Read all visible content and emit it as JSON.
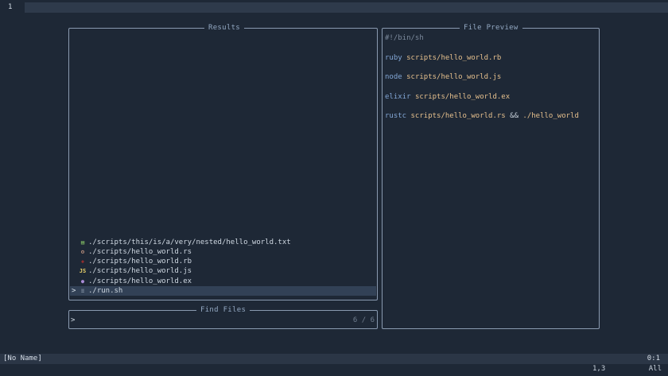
{
  "editor": {
    "line_number": "1"
  },
  "results_panel": {
    "title": "Results",
    "items": [
      {
        "path": "./scripts/this/is/a/very/nested/hello_world.txt",
        "icon": "text-file-icon",
        "icon_glyph": "▤",
        "icon_color": "#8fcf6a",
        "selected": false,
        "caret": ""
      },
      {
        "path": "./scripts/hello_world.rs",
        "icon": "rust-icon",
        "icon_glyph": "⚙",
        "icon_color": "#d9a48a",
        "selected": false,
        "caret": ""
      },
      {
        "path": "./scripts/hello_world.rb",
        "icon": "ruby-icon",
        "icon_glyph": "◆",
        "icon_color": "#8f2f2f",
        "selected": false,
        "caret": ""
      },
      {
        "path": "./scripts/hello_world.js",
        "icon": "javascript-icon",
        "icon_glyph": "JS",
        "icon_color": "#e9d26a",
        "selected": false,
        "caret": ""
      },
      {
        "path": "./scripts/hello_world.ex",
        "icon": "elixir-icon",
        "icon_glyph": "●",
        "icon_color": "#a98bd6",
        "selected": false,
        "caret": ""
      },
      {
        "path": "./run.sh",
        "icon": "shell-icon",
        "icon_glyph": "≡",
        "icon_color": "#8a97a8",
        "selected": true,
        "caret": ">"
      }
    ]
  },
  "prompt_panel": {
    "title": "Find Files",
    "prompt_symbol": ">",
    "count": "6 / 6"
  },
  "preview_panel": {
    "title": "File Preview",
    "lines": [
      {
        "parts": [
          {
            "t": "#!/bin/sh",
            "c": "cmt"
          }
        ]
      },
      {
        "parts": []
      },
      {
        "parts": [
          {
            "t": "ruby",
            "c": "kw"
          },
          {
            "t": " ",
            "c": "op"
          },
          {
            "t": "scripts/hello_world.rb",
            "c": "arg"
          }
        ]
      },
      {
        "parts": []
      },
      {
        "parts": [
          {
            "t": "node",
            "c": "kw"
          },
          {
            "t": " ",
            "c": "op"
          },
          {
            "t": "scripts/hello_world.js",
            "c": "arg"
          }
        ]
      },
      {
        "parts": []
      },
      {
        "parts": [
          {
            "t": "elixir",
            "c": "kw"
          },
          {
            "t": " ",
            "c": "op"
          },
          {
            "t": "scripts/hello_world.ex",
            "c": "arg"
          }
        ]
      },
      {
        "parts": []
      },
      {
        "parts": [
          {
            "t": "rustc",
            "c": "kw"
          },
          {
            "t": " ",
            "c": "op"
          },
          {
            "t": "scripts/hello_world.rs",
            "c": "arg"
          },
          {
            "t": " && ",
            "c": "op"
          },
          {
            "t": "./hello_world",
            "c": "arg"
          }
        ]
      }
    ]
  },
  "statusbar": {
    "buffer_name": "[No Name]",
    "position_right": "0:1"
  },
  "cmdline": {
    "cursor_pos": "1,3",
    "scroll": "All"
  }
}
